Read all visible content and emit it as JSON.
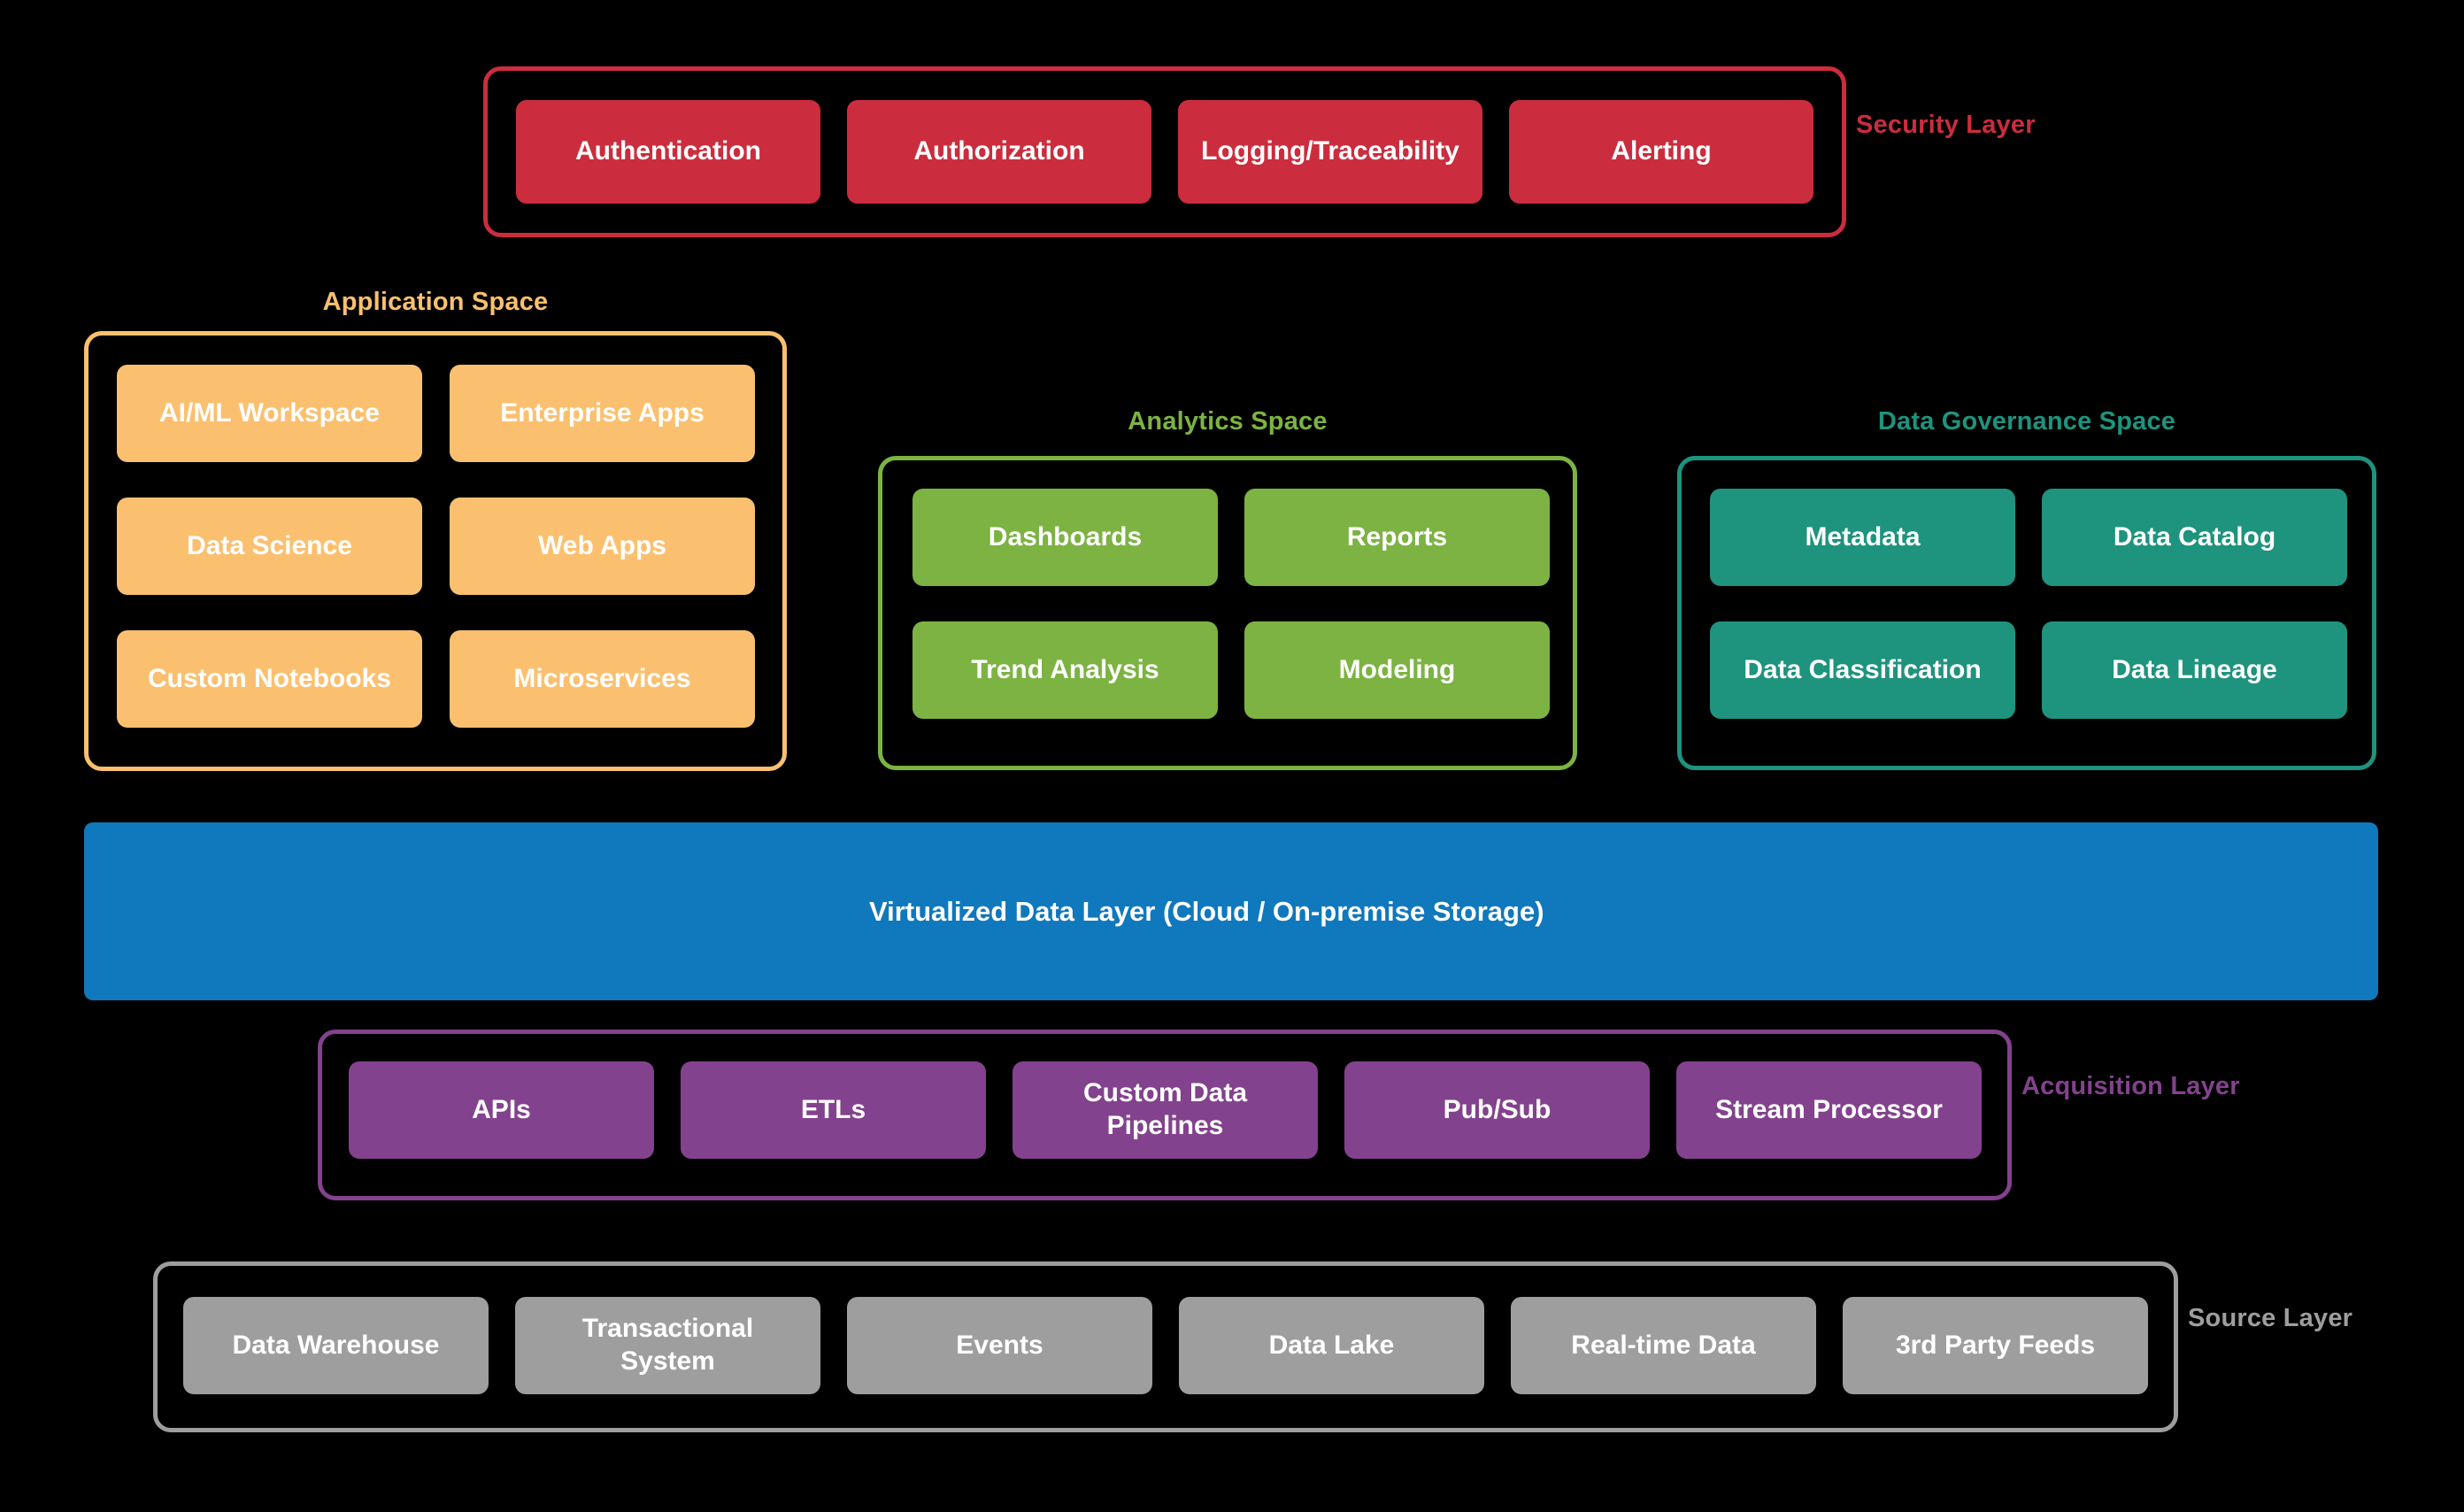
{
  "diagram": {
    "title": "Data platform layered architecture",
    "background": "#000000"
  },
  "palette": {
    "security_red": "#CB2D3E",
    "application_orange": "#FBC06F",
    "analytics_green": "#7CB342",
    "governance_teal": "#1E937E",
    "virtualized_blue": "#1078BC",
    "acquisition_purple": "#83428D",
    "source_gray": "#9E9E9E",
    "node_text": "#FFFFFF"
  },
  "groups": {
    "security": {
      "label": "Security Layer",
      "label_position": "right",
      "color": "#CB2D3E",
      "nodes": [
        {
          "label": "Authentication"
        },
        {
          "label": "Authorization"
        },
        {
          "label": "Logging/Traceability"
        },
        {
          "label": "Alerting"
        }
      ]
    },
    "application": {
      "label": "Application Space",
      "label_position": "top",
      "color": "#FBC06F",
      "nodes": [
        {
          "label": "AI/ML Workspace"
        },
        {
          "label": "Enterprise Apps"
        },
        {
          "label": "Data Science"
        },
        {
          "label": "Web Apps"
        },
        {
          "label": "Custom Notebooks"
        },
        {
          "label": "Microservices"
        }
      ]
    },
    "analytics": {
      "label": "Analytics Space",
      "label_position": "top",
      "color": "#7CB342",
      "nodes": [
        {
          "label": "Dashboards"
        },
        {
          "label": "Reports"
        },
        {
          "label": "Trend Analysis"
        },
        {
          "label": "Modeling"
        }
      ]
    },
    "governance": {
      "label": "Data Governance Space",
      "label_position": "top",
      "color": "#1E937E",
      "nodes": [
        {
          "label": "Metadata"
        },
        {
          "label": "Data Catalog"
        },
        {
          "label": "Data Classification"
        },
        {
          "label": "Data Lineage"
        }
      ]
    },
    "virtualized": {
      "label": "Virtualized Data Layer (Cloud / On-premise Storage)",
      "color": "#1078BC"
    },
    "acquisition": {
      "label": "Acquisition Layer",
      "label_position": "right",
      "color": "#83428D",
      "nodes": [
        {
          "label": "APIs"
        },
        {
          "label": "ETLs"
        },
        {
          "label": "Custom Data\nPipelines"
        },
        {
          "label": "Pub/Sub"
        },
        {
          "label": "Stream Processor"
        }
      ]
    },
    "source": {
      "label": "Source Layer",
      "label_position": "right",
      "color": "#9E9E9E",
      "nodes": [
        {
          "label": "Data Warehouse"
        },
        {
          "label": "Transactional\nSystem"
        },
        {
          "label": "Events"
        },
        {
          "label": "Data Lake"
        },
        {
          "label": "Real-time Data"
        },
        {
          "label": "3rd Party Feeds"
        }
      ]
    }
  }
}
